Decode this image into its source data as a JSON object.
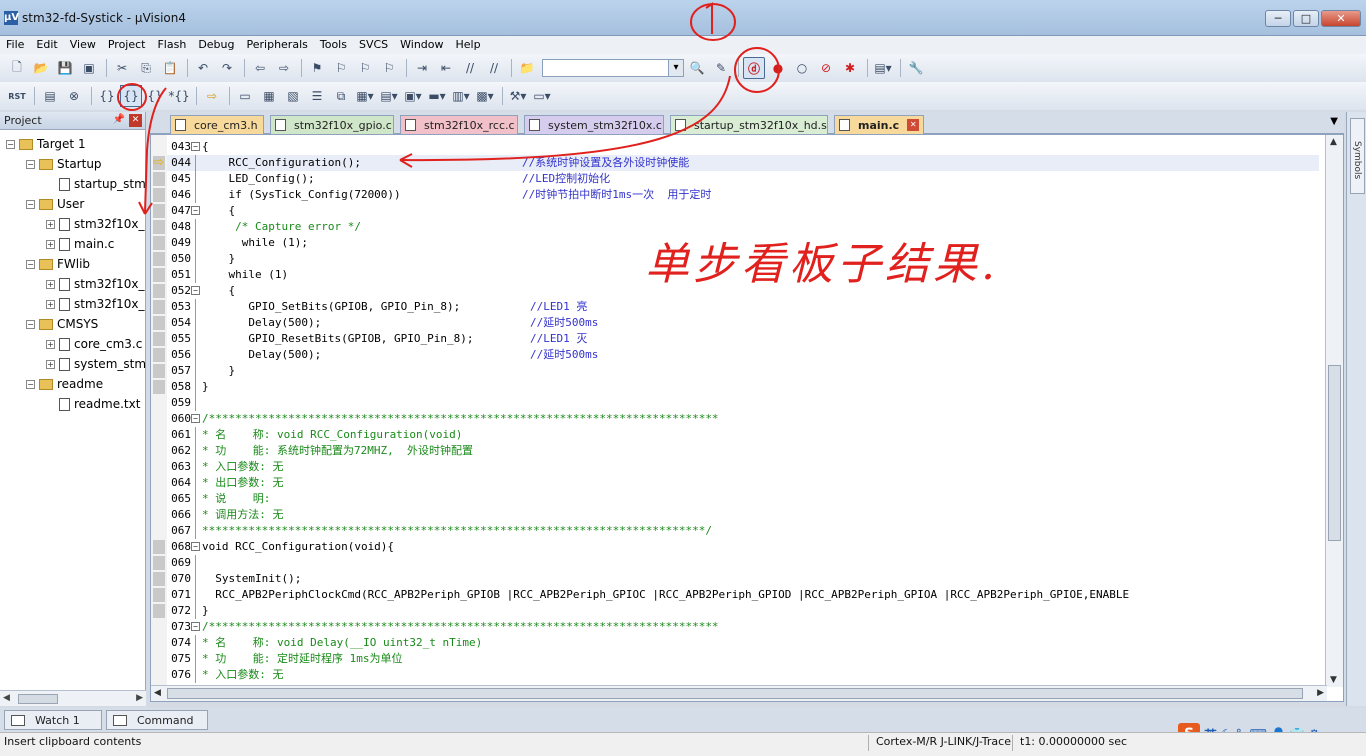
{
  "window": {
    "title": "stm32-fd-Systick - µVision4",
    "app_icon": "µV",
    "buttons": [
      "─",
      "□",
      "✕"
    ]
  },
  "menu": [
    "File",
    "Edit",
    "View",
    "Project",
    "Flash",
    "Debug",
    "Peripherals",
    "Tools",
    "SVCS",
    "Window",
    "Help"
  ],
  "toolbar1": {
    "icons": [
      "new-file-icon",
      "open-file-icon",
      "save-icon",
      "save-all-icon",
      "cut-icon",
      "copy-icon",
      "paste-icon",
      "undo-icon",
      "redo-icon",
      "nav-back-icon",
      "nav-forward-icon",
      "bookmark-icon",
      "bookmark-prev-icon",
      "bookmark-next-icon",
      "bookmark-clear-icon",
      "indent-icon",
      "unindent-icon",
      "comment-icon",
      "uncomment-icon",
      "find-in-files-icon"
    ],
    "find_combo_value": "",
    "debug_icons": [
      "find-icon",
      "debug-start-icon",
      "breakpoint-icon",
      "breakpoint-disabled-icon",
      "breakpoint-kill-icon",
      "breakpoint-all-icon",
      "window-config-icon",
      "configure-icon"
    ]
  },
  "toolbar2": {
    "icons": [
      "reset-icon",
      "run-icon",
      "stop-icon",
      "step-into-icon",
      "step-over-icon",
      "step-out-icon",
      "run-to-cursor-icon",
      "show-next-statement-icon",
      "command-window-icon",
      "disassembly-icon",
      "symbols-window-icon",
      "registers-window-icon",
      "call-stack-icon",
      "watch-window-icon",
      "memory-window-icon",
      "serial-window-icon",
      "analysis-window-icon",
      "trace-window-icon",
      "system-viewer-icon",
      "toolbox-icon",
      "debug-restore-icon"
    ],
    "reset_label": "RST"
  },
  "project_panel": {
    "title": "Project",
    "items": [
      {
        "label": "Target 1",
        "type": "target",
        "depth": 0,
        "expanded": true
      },
      {
        "label": "Startup",
        "type": "folder",
        "depth": 1,
        "expanded": true
      },
      {
        "label": "startup_stm",
        "type": "file",
        "depth": 2
      },
      {
        "label": "User",
        "type": "folder",
        "depth": 1,
        "expanded": true
      },
      {
        "label": "stm32f10x_",
        "type": "file",
        "depth": 2
      },
      {
        "label": "main.c",
        "type": "file",
        "depth": 2
      },
      {
        "label": "FWlib",
        "type": "folder",
        "depth": 1,
        "expanded": true
      },
      {
        "label": "stm32f10x_",
        "type": "file",
        "depth": 2
      },
      {
        "label": "stm32f10x_",
        "type": "file",
        "depth": 2
      },
      {
        "label": "CMSYS",
        "type": "folder",
        "depth": 1,
        "expanded": true
      },
      {
        "label": "core_cm3.c",
        "type": "file",
        "depth": 2
      },
      {
        "label": "system_stm",
        "type": "file",
        "depth": 2
      },
      {
        "label": "readme",
        "type": "folder",
        "depth": 1,
        "expanded": true
      },
      {
        "label": "readme.txt",
        "type": "file",
        "depth": 2
      }
    ]
  },
  "tabs": [
    {
      "label": "core_cm3.h",
      "color": "#f7d99c",
      "active": false
    },
    {
      "label": "stm32f10x_gpio.c",
      "color": "#cfe6c9",
      "active": false
    },
    {
      "label": "stm32f10x_rcc.c",
      "color": "#f2c0c8",
      "active": false
    },
    {
      "label": "system_stm32f10x.c",
      "color": "#d6cdee",
      "active": false
    },
    {
      "label": "startup_stm32f10x_hd.s",
      "color": "#d9ecd4",
      "active": false
    },
    {
      "label": "main.c",
      "color": "#f7d99c",
      "active": true
    }
  ],
  "editor": {
    "current_line": "044",
    "lines": [
      {
        "n": "043",
        "code": "{",
        "comment": ""
      },
      {
        "n": "044",
        "code": "    RCC_Configuration();",
        "comment": "//系统时钟设置及各外设时钟使能"
      },
      {
        "n": "045",
        "code": "    LED_Config();",
        "comment": "//LED控制初始化"
      },
      {
        "n": "046",
        "code": "    if (SysTick_Config(72000))",
        "comment": "//时钟节拍中断时1ms一次  用于定时"
      },
      {
        "n": "047",
        "code": "    {",
        "comment": ""
      },
      {
        "n": "048",
        "code": "     /* Capture error */",
        "comment": ""
      },
      {
        "n": "049",
        "code": "      while (1);",
        "comment": ""
      },
      {
        "n": "050",
        "code": "    }",
        "comment": ""
      },
      {
        "n": "051",
        "code": "    while (1)",
        "comment": ""
      },
      {
        "n": "052",
        "code": "    {",
        "comment": ""
      },
      {
        "n": "053",
        "code": "       GPIO_SetBits(GPIOB, GPIO_Pin_8);",
        "comment": "//LED1 亮"
      },
      {
        "n": "054",
        "code": "       Delay(500);",
        "comment": "//延时500ms"
      },
      {
        "n": "055",
        "code": "       GPIO_ResetBits(GPIOB, GPIO_Pin_8);",
        "comment": "//LED1 灭"
      },
      {
        "n": "056",
        "code": "       Delay(500);",
        "comment": "//延时500ms"
      },
      {
        "n": "057",
        "code": "    }",
        "comment": ""
      },
      {
        "n": "058",
        "code": "}",
        "comment": ""
      },
      {
        "n": "059",
        "code": "",
        "comment": ""
      },
      {
        "n": "060",
        "code": "",
        "comment": "/*****************************************************************************"
      },
      {
        "n": "061",
        "code": "",
        "comment": "* 名    称: void RCC_Configuration(void)"
      },
      {
        "n": "062",
        "code": "",
        "comment": "* 功    能: 系统时钟配置为72MHZ,  外设时钟配置"
      },
      {
        "n": "063",
        "code": "",
        "comment": "* 入口参数: 无"
      },
      {
        "n": "064",
        "code": "",
        "comment": "* 出口参数: 无"
      },
      {
        "n": "065",
        "code": "",
        "comment": "* 说    明:"
      },
      {
        "n": "066",
        "code": "",
        "comment": "* 调用方法: 无"
      },
      {
        "n": "067",
        "code": "",
        "comment": "****************************************************************************/"
      },
      {
        "n": "068",
        "code": "void RCC_Configuration(void){",
        "comment": ""
      },
      {
        "n": "069",
        "code": "",
        "comment": ""
      },
      {
        "n": "070",
        "code": "  SystemInit();",
        "comment": ""
      },
      {
        "n": "071",
        "code": "  RCC_APB2PeriphClockCmd(RCC_APB2Periph_GPIOB |RCC_APB2Periph_GPIOC |RCC_APB2Periph_GPIOD |RCC_APB2Periph_GPIOA |RCC_APB2Periph_GPIOE,ENABLE",
        "comment": ""
      },
      {
        "n": "072",
        "code": "}",
        "comment": ""
      },
      {
        "n": "073",
        "code": "",
        "comment": "/*****************************************************************************"
      },
      {
        "n": "074",
        "code": "",
        "comment": "* 名    称: void Delay(__IO uint32_t nTime)"
      },
      {
        "n": "075",
        "code": "",
        "comment": "* 功    能: 定时延时程序 1ms为单位"
      },
      {
        "n": "076",
        "code": "",
        "comment": "* 入口参数: 无"
      }
    ]
  },
  "right_dock": {
    "label": "Symbols"
  },
  "bottom_tabs": [
    "Watch 1",
    "Command"
  ],
  "status": {
    "message": "Insert clipboard contents",
    "debugger": "Cortex-M/R J-LINK/J-Trace",
    "time": "t1: 0.00000000 sec"
  },
  "ime": {
    "lang": "英",
    "brand": "S"
  },
  "annotation": {
    "handwriting": "单步看板子结果.",
    "color": "#e0211d"
  }
}
